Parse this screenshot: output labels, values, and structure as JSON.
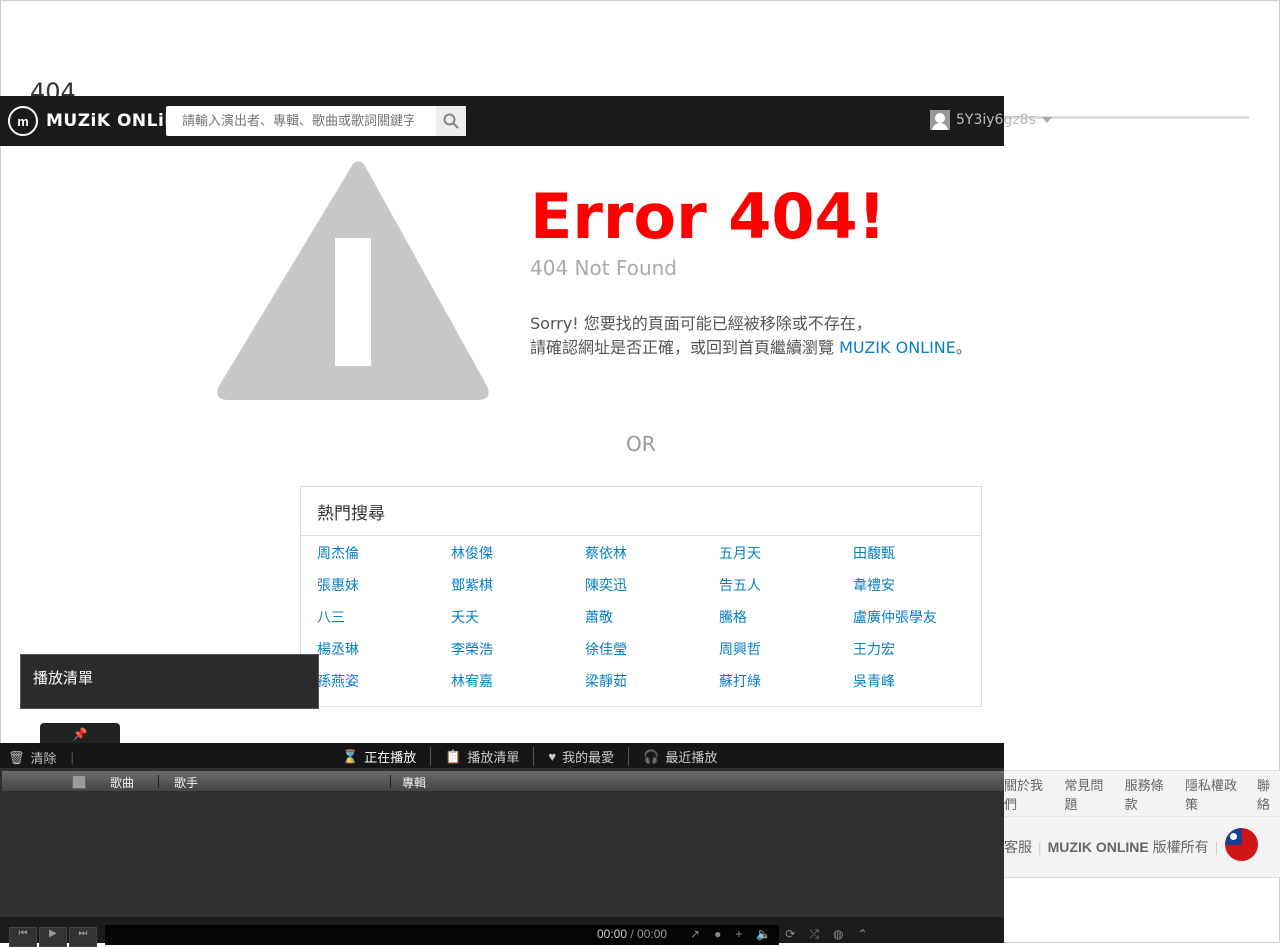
{
  "background": {
    "heading": "404"
  },
  "header": {
    "logo_icon": "m-logo-icon",
    "logo_text": "MUZiK ONLiNE",
    "search_placeholder": "請輸入演出者、專輯、歌曲或歌詞關鍵字",
    "username": "5Y3iy6gz8s"
  },
  "error": {
    "title": "Error 404!",
    "subtitle": "404 Not Found",
    "message_lead": "Sorry! 您要找的頁面可能已經被移除或不存在，",
    "message_line2": "請確認網址是否正確，或回到首頁繼續瀏覽",
    "message_link": "MUZIK ONLINE",
    "message_tail": "。",
    "or": "OR"
  },
  "popular": {
    "title": "熱門搜尋",
    "links": [
      "周杰倫",
      "林俊傑",
      "蔡依林",
      "五月天",
      "田馥甄",
      "張惠妹",
      "鄧紫棋",
      "陳奕迅",
      "告五人",
      "韋禮安",
      "八三",
      "夭夭",
      "蕭敬",
      "騰格",
      "盧廣仲張學友",
      "楊丞琳",
      "李榮浩",
      "徐佳瑩",
      "周興哲",
      "王力宏",
      "孫燕姿",
      "林宥嘉",
      "梁靜茹",
      "蘇打綠",
      "吳青峰"
    ]
  },
  "footer": {
    "row1": [
      "關於我們",
      "常見問題",
      "服務條款",
      "隱私權政策",
      "聯絡"
    ],
    "row2_prefix": "客服",
    "row2_brand": "MUZIK ONLINE",
    "row2_suffix": "版權所有"
  },
  "tooltip": {
    "text": "播放清單"
  },
  "pin_icon": "pin-icon",
  "dock": {
    "left_label": "清除",
    "tabs": [
      "正在播放",
      "播放清單",
      "我的最愛",
      "最近播放"
    ],
    "columns": [
      "歌曲",
      "歌手",
      "專輯"
    ],
    "time_current": "00:00",
    "time_total": "/ 00:00"
  },
  "colors": {
    "accent": "#f00",
    "link": "#0a7fc2",
    "header_bg": "#1a1a1a"
  }
}
